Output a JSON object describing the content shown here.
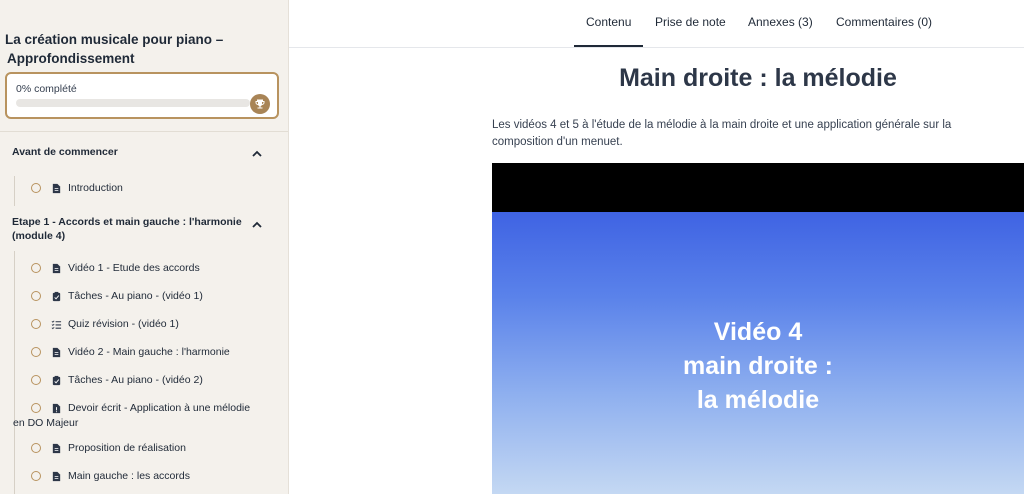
{
  "sidebar": {
    "course_title_line1": "La création musicale pour piano –",
    "course_title_line2": "Approfondissement",
    "progress_label": "0% complété",
    "progress_fraction": 0,
    "sections": [
      {
        "title": "Avant de commencer",
        "lessons": [
          {
            "label": "Introduction",
            "type": "document-icon"
          }
        ]
      },
      {
        "title_line1": "Etape 1 - Accords et main gauche : l'harmonie",
        "title_line2": "(module 4)",
        "lessons": [
          {
            "label": "Vidéo 1 - Etude des accords",
            "type": "document-icon"
          },
          {
            "label": "Tâches - Au piano - (vidéo 1)",
            "type": "task-icon"
          },
          {
            "label": "Quiz révision - (vidéo 1)",
            "type": "quiz-list-icon"
          },
          {
            "label": "Vidéo 2 - Main gauche : l'harmonie",
            "type": "document-icon"
          },
          {
            "label": "Tâches - Au piano - (vidéo 2)",
            "type": "task-icon"
          },
          {
            "label_line1": "Devoir écrit - Application à une mélodie",
            "label_line2": "en DO Majeur",
            "type": "assignment-icon"
          },
          {
            "label": "Proposition de réalisation",
            "type": "document-icon"
          },
          {
            "label": "Main gauche : les accords",
            "type": "document-icon"
          }
        ]
      }
    ]
  },
  "tabs": [
    {
      "label": "Contenu",
      "active": true
    },
    {
      "label": "Prise de note",
      "active": false
    },
    {
      "label": "Annexes (3)",
      "active": false
    },
    {
      "label": "Commentaires (0)",
      "active": false
    }
  ],
  "main": {
    "title": "Main droite : la mélodie",
    "description": "Les vidéos 4 et 5 à l'étude de la mélodie à la main droite et une application générale sur la composition d'un menuet.",
    "video": {
      "line1": "Vidéo 4",
      "line2": "main droite :",
      "line3": "la mélodie"
    }
  },
  "colors": {
    "accent": "#b8935f",
    "sidebar_bg": "#f4f1ec",
    "video_gradient_top": "#3f63e3",
    "video_gradient_bottom": "#c4d8f3"
  }
}
